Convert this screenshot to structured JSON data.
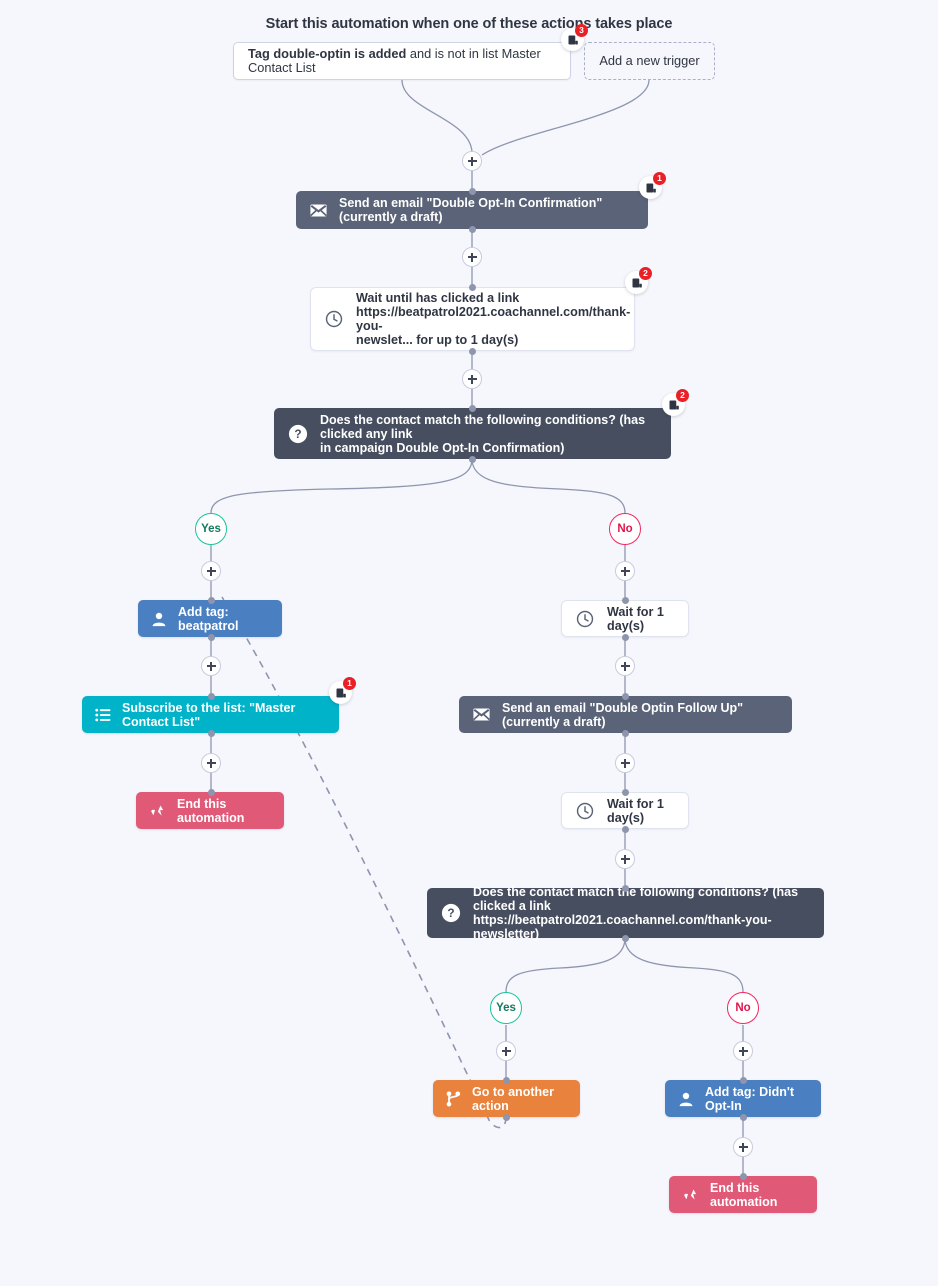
{
  "heading": "Start this automation when one of these actions takes place",
  "triggers": [
    {
      "name": "trigger-tag-added",
      "bold_text": "Tag double-optin is added",
      "rest_text": " and is not in list Master Contact List",
      "badge": "3"
    },
    {
      "name": "add-trigger",
      "label": "Add a new trigger"
    }
  ],
  "nodes": {
    "send_email_confirmation": {
      "label": "Send an email \"Double Opt-In Confirmation\" (currently a draft)",
      "icon": "envelope-icon",
      "badge": "1",
      "color": "#5a6377"
    },
    "wait_until_clicked": {
      "label": "Wait until has clicked a link https://beatpatrol2021.coachannel.com/thank-you-newslet... for up to 1 day(s)",
      "line1": "Wait until has clicked a link",
      "line2": "https://beatpatrol2021.coachannel.com/thank-you-",
      "line3": "newslet... for up to 1 day(s)",
      "icon": "clock-icon",
      "badge": "2",
      "color": "#ffffff"
    },
    "condition_one": {
      "line1": "Does the contact match the following conditions? (has clicked any link",
      "line2": "in campaign Double Opt-In Confirmation)",
      "icon": "question-icon",
      "badge": "2",
      "color": "#474e5f"
    },
    "add_tag_beatpatrol": {
      "label": "Add tag: beatpatrol",
      "icon": "user-icon",
      "color": "#4a7fc1"
    },
    "subscribe_list": {
      "label": "Subscribe to the list: \"Master Contact List\"",
      "icon": "list-icon",
      "badge": "1",
      "color": "#00b3c8"
    },
    "end_automation_left": {
      "label": "End this automation",
      "icon": "end-cycle-icon",
      "color": "#e05a78"
    },
    "wait_one_day_first": {
      "label": "Wait for 1 day(s)",
      "icon": "clock-icon",
      "color": "#ffffff"
    },
    "send_email_followup": {
      "label": "Send an email \"Double Optin Follow Up\" (currently a draft)",
      "icon": "envelope-icon",
      "color": "#5a6377"
    },
    "wait_one_day_second": {
      "label": "Wait for 1 day(s)",
      "icon": "clock-icon",
      "color": "#ffffff"
    },
    "condition_two": {
      "line1": "Does the contact match the following conditions? (has clicked a link",
      "line2": "https://beatpatrol2021.coachannel.com/thank-you-newsletter)",
      "icon": "question-icon",
      "color": "#474e5f"
    },
    "goto_action": {
      "label": "Go to another action",
      "icon": "branch-icon",
      "color": "#e8823c"
    },
    "add_tag_didnt_optin": {
      "label": "Add tag: Didn't Opt-In",
      "icon": "user-icon",
      "color": "#4a7fc1"
    },
    "end_automation_right": {
      "label": "End this automation",
      "icon": "end-cycle-icon",
      "color": "#e05a78"
    }
  },
  "branch_labels": {
    "yes_top": "Yes",
    "no_top": "No",
    "yes_bottom": "Yes",
    "no_bottom": "No"
  },
  "colors": {
    "background": "#f6f7fc",
    "connector": "#8d96ae",
    "yes": "#18c39a",
    "no": "#f4265e",
    "badge_red": "#ea2027"
  }
}
